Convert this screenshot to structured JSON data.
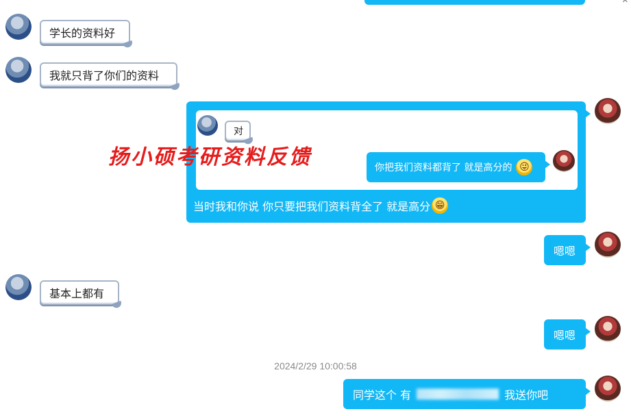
{
  "window": {
    "close_glyph": "⌃"
  },
  "messages": {
    "m1": {
      "text": "学长的资料好"
    },
    "m2": {
      "text": "我就只背了你们的资料"
    },
    "quote": {
      "inner_reply": "对",
      "quoted_text": "你把我们资料都背了 就是高分的",
      "quoted_emoji": "grinning-tongue-emoji",
      "main_text": "当时我和你说  你只要把我们资料背全了 就是高分",
      "main_emoji": "grin-emoji"
    },
    "m3": {
      "text": "嗯嗯"
    },
    "m4": {
      "text": "基本上都有"
    },
    "m5": {
      "text": "嗯嗯"
    },
    "timestamp": "2024/2/29 10:00:58",
    "m6": {
      "text_before": "同学这个  有",
      "text_after": "我送你吧"
    }
  },
  "watermark": "扬小硕考研资料反馈",
  "colors": {
    "self_bubble": "#12b7f5",
    "watermark": "#e51c1c",
    "frame_border": "#a6b4c6"
  }
}
